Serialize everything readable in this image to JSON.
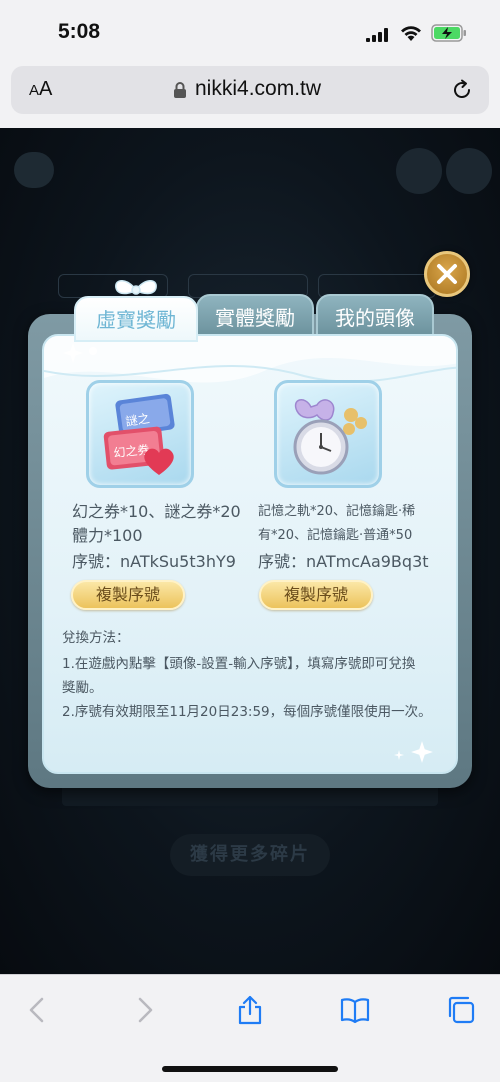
{
  "status_bar": {
    "time": "5:08",
    "icons": [
      "signal-icon",
      "wifi-icon",
      "battery-charging-icon"
    ]
  },
  "browser": {
    "aa_label_small": "A",
    "aa_label_large": "A",
    "url": "nikki4.com.tw",
    "icons": [
      "lock-icon",
      "reload-icon"
    ]
  },
  "page": {
    "more_button": "獲得更多碎片"
  },
  "modal": {
    "tabs": [
      {
        "label": "虛寶獎勵",
        "active": true
      },
      {
        "label": "實體獎勵",
        "active": false
      },
      {
        "label": "我的頭像",
        "active": false
      }
    ],
    "rewards": [
      {
        "icon": "tickets-icon",
        "line1": "幻之券*10、謎之券*20",
        "line2": "體力*100",
        "serial": "序號：nATkSu5t3hY9",
        "copy_label": "複製序號"
      },
      {
        "icon": "pocket-watch-icon",
        "line1": "記憶之軌*20、記憶鑰匙·稀",
        "line2": "有*20、記憶鑰匙·普通*50",
        "serial": "序號：nATmcAa9Bq3t",
        "copy_label": "複製序號"
      }
    ],
    "instructions": {
      "title": "兌換方法：",
      "step1a": "1.在遊戲內點擊【頭像-設置-輸入序號】，填寫序號即可兌換",
      "step1b": "獎勵。",
      "step2": "2.序號有效期限至11月20日23:59，每個序號僅限使用一次。"
    }
  },
  "colors": {
    "tab_active_text": "#6fb6d4",
    "copy_button": "#ecc35c",
    "close_button": "#c28b35"
  },
  "toolbar": {
    "icons": [
      "back-icon",
      "forward-icon",
      "share-icon",
      "bookmarks-icon",
      "tabs-icon"
    ]
  }
}
